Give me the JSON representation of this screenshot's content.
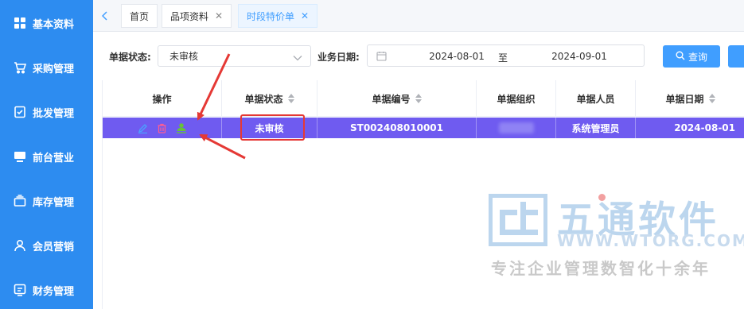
{
  "sidebar": {
    "items": [
      {
        "label": "基本资料",
        "icon": "grid-icon"
      },
      {
        "label": "采购管理",
        "icon": "cart-icon"
      },
      {
        "label": "批发管理",
        "icon": "checkbox-icon"
      },
      {
        "label": "前台营业",
        "icon": "monitor-icon"
      },
      {
        "label": "库存管理",
        "icon": "stack-icon"
      },
      {
        "label": "会员营销",
        "icon": "user-icon"
      },
      {
        "label": "财务管理",
        "icon": "finance-icon"
      }
    ]
  },
  "tabs": [
    {
      "label": "首页",
      "closable": false
    },
    {
      "label": "品项资料",
      "closable": true
    },
    {
      "label": "时段特价单",
      "closable": true,
      "active": true
    }
  ],
  "tab_close_glyph": "✕",
  "filter": {
    "status_label": "单据状态:",
    "status_value": "未审核",
    "date_label": "业务日期:",
    "date_start": "2024-08-01",
    "date_separator": "至",
    "date_end": "2024-09-01",
    "query_label": "查询"
  },
  "table": {
    "headers": {
      "ops": "操作",
      "status": "单据状态",
      "number": "单据编号",
      "org": "单据组织",
      "person": "单据人员",
      "date": "单据日期"
    },
    "rows": [
      {
        "status": "未审核",
        "number": "ST002408010001",
        "org": "",
        "person": "系统管理员",
        "date": "2024-08-01"
      }
    ],
    "row_highlight_color": "#6f5bf0"
  },
  "watermark": {
    "name": "五通软件",
    "url": "WWW.WTORG.COM",
    "slogan": "专注企业管理数智化十余年"
  },
  "colors": {
    "sidebar": "#2d8cf0",
    "primary": "#409eff",
    "annotation": "#e53935"
  }
}
